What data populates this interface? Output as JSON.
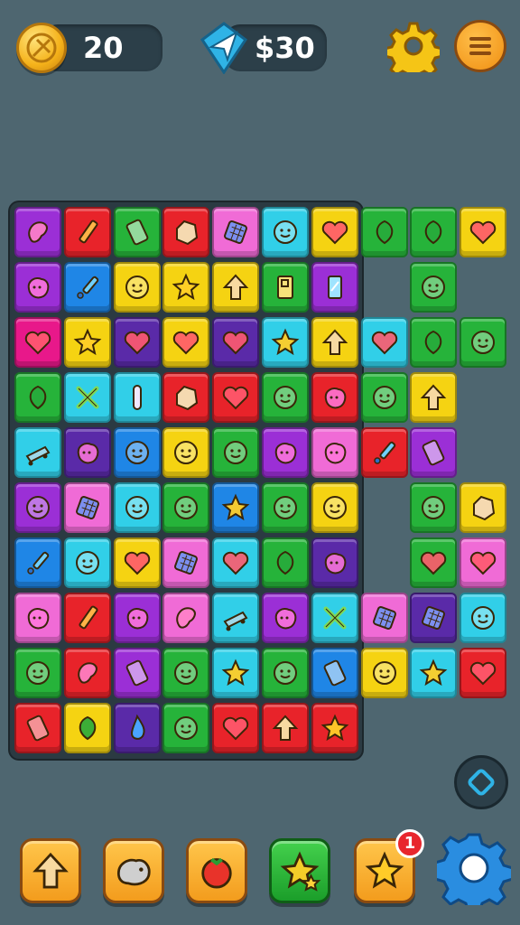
{
  "hud": {
    "coins": "20",
    "money": "$30",
    "icons": {
      "coin": "coin-icon",
      "gem": "paper-plane-gem-icon",
      "settings": "gear-icon",
      "menu": "hamburger-menu-icon"
    }
  },
  "colors": {
    "background": "#4e6670",
    "board": "#2b3a42",
    "purple": "#9b2fd6",
    "red": "#e8232a",
    "green": "#26b33a",
    "pink": "#f06bd6",
    "cyan": "#31cfe8",
    "yellow": "#f5d312",
    "blue": "#1f86e6",
    "darkpurple": "#5a2aa8",
    "magenta": "#e8188a"
  },
  "board": {
    "cols": 10,
    "tiles": [
      [
        "purple",
        "bean"
      ],
      [
        "red",
        "pencil"
      ],
      [
        "green",
        "domino"
      ],
      [
        "red",
        "rock"
      ],
      [
        "pink",
        "waffle"
      ],
      [
        "cyan",
        "smiley"
      ],
      [
        "yellow",
        "heart"
      ],
      [
        "green",
        "leaf"
      ],
      [
        "green",
        "leaf"
      ],
      [
        "yellow",
        "heart"
      ],
      [
        "purple",
        "blob"
      ],
      [
        "blue",
        "dropper"
      ],
      [
        "yellow",
        "smiley"
      ],
      [
        "yellow",
        "star"
      ],
      [
        "yellow",
        "arrow"
      ],
      [
        "green",
        "p-block"
      ],
      [
        "purple",
        "glass"
      ],
      null,
      [
        "green",
        "smiley"
      ],
      null,
      [
        "magenta",
        "heart"
      ],
      [
        "yellow",
        "star"
      ],
      [
        "darkpurple",
        "heart"
      ],
      [
        "yellow",
        "heart"
      ],
      [
        "darkpurple",
        "heart"
      ],
      [
        "cyan",
        "star"
      ],
      [
        "yellow",
        "arrow"
      ],
      [
        "cyan",
        "heart"
      ],
      [
        "green",
        "leaf"
      ],
      [
        "green",
        "smiley"
      ],
      [
        "green",
        "leaf"
      ],
      [
        "cyan",
        "x-bars"
      ],
      [
        "cyan",
        "bar"
      ],
      [
        "red",
        "rock"
      ],
      [
        "red",
        "heart"
      ],
      [
        "green",
        "smiley"
      ],
      [
        "red",
        "blob"
      ],
      [
        "green",
        "smiley"
      ],
      [
        "yellow",
        "arrow"
      ],
      null,
      [
        "cyan",
        "skate"
      ],
      [
        "darkpurple",
        "blob"
      ],
      [
        "blue",
        "smiley"
      ],
      [
        "yellow",
        "smiley"
      ],
      [
        "green",
        "smiley"
      ],
      [
        "purple",
        "blob"
      ],
      [
        "pink",
        "blob"
      ],
      [
        "red",
        "dropper"
      ],
      [
        "purple",
        "domino"
      ],
      null,
      [
        "purple",
        "smiley"
      ],
      [
        "pink",
        "waffle"
      ],
      [
        "cyan",
        "smiley"
      ],
      [
        "green",
        "smiley"
      ],
      [
        "blue",
        "star"
      ],
      [
        "green",
        "smiley"
      ],
      [
        "yellow",
        "smiley"
      ],
      null,
      [
        "green",
        "smiley"
      ],
      [
        "yellow",
        "rock"
      ],
      [
        "blue",
        "dropper"
      ],
      [
        "cyan",
        "smiley"
      ],
      [
        "yellow",
        "heart"
      ],
      [
        "pink",
        "waffle"
      ],
      [
        "cyan",
        "heart"
      ],
      [
        "green",
        "leaf"
      ],
      [
        "darkpurple",
        "blob"
      ],
      null,
      [
        "green",
        "heart"
      ],
      [
        "pink",
        "heart"
      ],
      [
        "pink",
        "blob"
      ],
      [
        "red",
        "pencil"
      ],
      [
        "purple",
        "blob"
      ],
      [
        "pink",
        "bean"
      ],
      [
        "cyan",
        "skate"
      ],
      [
        "purple",
        "blob"
      ],
      [
        "cyan",
        "x-bars"
      ],
      [
        "pink",
        "waffle"
      ],
      [
        "darkpurple",
        "waffle"
      ],
      [
        "cyan",
        "smiley"
      ],
      [
        "green",
        "smiley"
      ],
      [
        "red",
        "bean"
      ],
      [
        "purple",
        "domino"
      ],
      [
        "green",
        "smiley"
      ],
      [
        "cyan",
        "star"
      ],
      [
        "green",
        "smiley"
      ],
      [
        "blue",
        "domino"
      ],
      [
        "yellow",
        "smiley"
      ],
      [
        "cyan",
        "star"
      ],
      [
        "red",
        "heart"
      ],
      [
        "red",
        "domino"
      ],
      [
        "yellow",
        "leaf"
      ],
      [
        "darkpurple",
        "drop"
      ],
      [
        "green",
        "smiley"
      ],
      [
        "red",
        "heart"
      ],
      [
        "red",
        "arrow"
      ],
      [
        "red",
        "star"
      ],
      null,
      null,
      null
    ]
  },
  "powerups": [
    {
      "name": "powerup-arrow-button",
      "icon": "up-arrow-icon",
      "color": "orange"
    },
    {
      "name": "powerup-animal-button",
      "icon": "animal-icon",
      "color": "orange"
    },
    {
      "name": "powerup-tomato-button",
      "icon": "tomato-icon",
      "color": "orange"
    },
    {
      "name": "powerup-stars-button",
      "icon": "stars-icon",
      "color": "green"
    },
    {
      "name": "powerup-star-button",
      "icon": "star-icon",
      "color": "orange",
      "badge": "1"
    }
  ],
  "shuffle_icon": "shuffle-diamond-icon",
  "settings_cog_icon": "cog-icon"
}
